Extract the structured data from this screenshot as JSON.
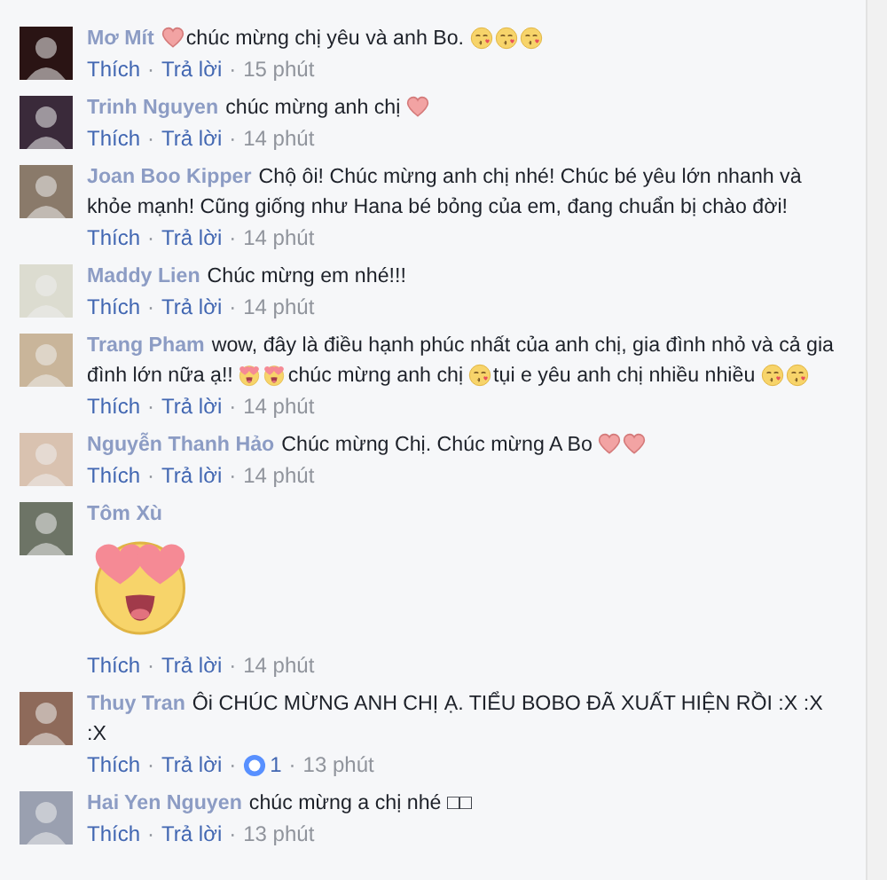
{
  "separator": "·",
  "comments": [
    {
      "author": "Mơ Mít",
      "body": [
        {
          "kind": "heart"
        },
        {
          "kind": "text",
          "text": "chúc mừng chị yêu và anh Bo."
        },
        {
          "kind": "kiss"
        },
        {
          "kind": "kiss"
        },
        {
          "kind": "kiss"
        }
      ],
      "like": "Thích",
      "reply": "Trả lời",
      "time": "15 phút"
    },
    {
      "author": "Trinh Nguyen",
      "body": [
        {
          "kind": "text",
          "text": "chúc mừng anh chị"
        },
        {
          "kind": "heart"
        }
      ],
      "like": "Thích",
      "reply": "Trả lời",
      "time": "14 phút"
    },
    {
      "author": "Joan Boo Kipper",
      "body": [
        {
          "kind": "text",
          "text": "Chộ ôi! Chúc mừng anh chị nhé! Chúc bé yêu lớn nhanh và khỏe mạnh! Cũng giống như Hana bé bỏng của em, đang chuẩn bị chào đời!"
        }
      ],
      "like": "Thích",
      "reply": "Trả lời",
      "time": "14 phút"
    },
    {
      "author": "Maddy Lien",
      "body": [
        {
          "kind": "text",
          "text": "Chúc mừng em nhé!!!"
        }
      ],
      "like": "Thích",
      "reply": "Trả lời",
      "time": "14 phút"
    },
    {
      "author": "Trang Pham",
      "body": [
        {
          "kind": "text",
          "text": "wow, đây là điều hạnh phúc nhất của anh chị, gia đình nhỏ và cả gia đình lớn nữa ạ!!"
        },
        {
          "kind": "heart-eyes"
        },
        {
          "kind": "heart-eyes"
        },
        {
          "kind": "text",
          "text": "chúc mừng anh chị"
        },
        {
          "kind": "kiss"
        },
        {
          "kind": "text",
          "text": "tụi e yêu anh chị nhiều nhiều"
        },
        {
          "kind": "kiss"
        },
        {
          "kind": "kiss"
        }
      ],
      "like": "Thích",
      "reply": "Trả lời",
      "time": "14 phút"
    },
    {
      "author": "Nguyễn Thanh Hảo",
      "body": [
        {
          "kind": "text",
          "text": "Chúc mừng Chị. Chúc mừng A Bo"
        },
        {
          "kind": "heart"
        },
        {
          "kind": "heart"
        }
      ],
      "like": "Thích",
      "reply": "Trả lời",
      "time": "14 phút"
    },
    {
      "author": "Tôm Xù",
      "sticker": {
        "kind": "heart-eyes"
      },
      "like": "Thích",
      "reply": "Trả lời",
      "time": "14 phút"
    },
    {
      "author": "Thuy Tran",
      "body": [
        {
          "kind": "text",
          "text": "Ôi CHÚC MỪNG ANH CHỊ Ạ. TIỂU BOBO ĐÃ XUẤT HIỆN RỒI :X :X :X"
        }
      ],
      "like": "Thích",
      "reply": "Trả lời",
      "reactions": "1",
      "time": "13 phút"
    },
    {
      "author": "Hai Yen Nguyen",
      "body": [
        {
          "kind": "text",
          "text": "chúc mừng a chị nhé □□"
        }
      ],
      "like": "Thích",
      "reply": "Trả lời",
      "time": "13 phút"
    }
  ]
}
